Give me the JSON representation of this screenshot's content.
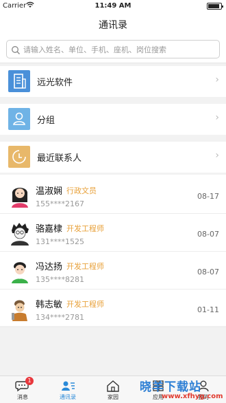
{
  "status_bar": {
    "carrier": "Carrier",
    "time": "11:49 AM"
  },
  "nav": {
    "title": "通讯录"
  },
  "search": {
    "placeholder": "请输入姓名、单位、手机、座机、岗位搜索"
  },
  "entries": [
    {
      "label": "远光软件",
      "icon": "building-icon",
      "color": "#4a90d9"
    },
    {
      "label": "分组",
      "icon": "group-icon",
      "color": "#6fb3e6"
    },
    {
      "label": "最近联系人",
      "icon": "clock-icon",
      "color": "#e8b86a"
    }
  ],
  "contacts": [
    {
      "name": "温淑娴",
      "role": "行政文员",
      "phone": "155****2167",
      "date": "08-17"
    },
    {
      "name": "骆嘉棣",
      "role": "开发工程师",
      "phone": "131****1525",
      "date": "08-07"
    },
    {
      "name": "冯达扬",
      "role": "开发工程师",
      "phone": "135****8281",
      "date": "08-07"
    },
    {
      "name": "韩志敏",
      "role": "开发工程师",
      "phone": "134****2781",
      "date": "01-11"
    }
  ],
  "tabbar": {
    "items": [
      {
        "label": "消息",
        "icon": "chat-icon",
        "badge": "1"
      },
      {
        "label": "通讯录",
        "icon": "contacts-icon",
        "active": true
      },
      {
        "label": "家园",
        "icon": "home-icon"
      },
      {
        "label": "应用",
        "icon": "apps-icon"
      },
      {
        "label": "我的",
        "icon": "profile-icon"
      }
    ]
  },
  "watermark": {
    "text": "晓羊下载站",
    "url": "www.xfhyg.com"
  },
  "colors": {
    "accent": "#2a8ad8",
    "role": "#e8a13a",
    "badge": "#e8383d"
  }
}
